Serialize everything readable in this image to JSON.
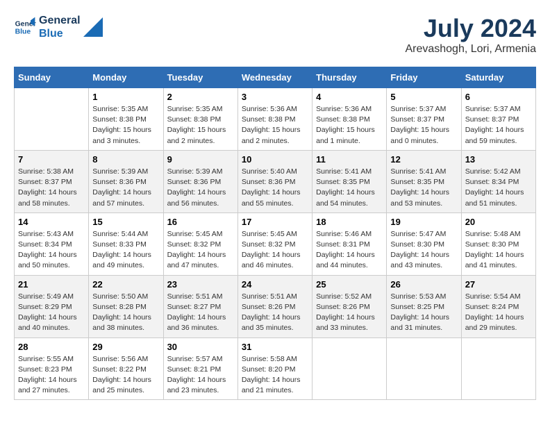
{
  "logo": {
    "line1": "General",
    "line2": "Blue"
  },
  "title": "July 2024",
  "subtitle": "Arevashogh, Lori, Armenia",
  "days_of_week": [
    "Sunday",
    "Monday",
    "Tuesday",
    "Wednesday",
    "Thursday",
    "Friday",
    "Saturday"
  ],
  "weeks": [
    [
      {
        "day": "",
        "sunrise": "",
        "sunset": "",
        "daylight": ""
      },
      {
        "day": "1",
        "sunrise": "Sunrise: 5:35 AM",
        "sunset": "Sunset: 8:38 PM",
        "daylight": "Daylight: 15 hours and 3 minutes."
      },
      {
        "day": "2",
        "sunrise": "Sunrise: 5:35 AM",
        "sunset": "Sunset: 8:38 PM",
        "daylight": "Daylight: 15 hours and 2 minutes."
      },
      {
        "day": "3",
        "sunrise": "Sunrise: 5:36 AM",
        "sunset": "Sunset: 8:38 PM",
        "daylight": "Daylight: 15 hours and 2 minutes."
      },
      {
        "day": "4",
        "sunrise": "Sunrise: 5:36 AM",
        "sunset": "Sunset: 8:38 PM",
        "daylight": "Daylight: 15 hours and 1 minute."
      },
      {
        "day": "5",
        "sunrise": "Sunrise: 5:37 AM",
        "sunset": "Sunset: 8:37 PM",
        "daylight": "Daylight: 15 hours and 0 minutes."
      },
      {
        "day": "6",
        "sunrise": "Sunrise: 5:37 AM",
        "sunset": "Sunset: 8:37 PM",
        "daylight": "Daylight: 14 hours and 59 minutes."
      }
    ],
    [
      {
        "day": "7",
        "sunrise": "Sunrise: 5:38 AM",
        "sunset": "Sunset: 8:37 PM",
        "daylight": "Daylight: 14 hours and 58 minutes."
      },
      {
        "day": "8",
        "sunrise": "Sunrise: 5:39 AM",
        "sunset": "Sunset: 8:36 PM",
        "daylight": "Daylight: 14 hours and 57 minutes."
      },
      {
        "day": "9",
        "sunrise": "Sunrise: 5:39 AM",
        "sunset": "Sunset: 8:36 PM",
        "daylight": "Daylight: 14 hours and 56 minutes."
      },
      {
        "day": "10",
        "sunrise": "Sunrise: 5:40 AM",
        "sunset": "Sunset: 8:36 PM",
        "daylight": "Daylight: 14 hours and 55 minutes."
      },
      {
        "day": "11",
        "sunrise": "Sunrise: 5:41 AM",
        "sunset": "Sunset: 8:35 PM",
        "daylight": "Daylight: 14 hours and 54 minutes."
      },
      {
        "day": "12",
        "sunrise": "Sunrise: 5:41 AM",
        "sunset": "Sunset: 8:35 PM",
        "daylight": "Daylight: 14 hours and 53 minutes."
      },
      {
        "day": "13",
        "sunrise": "Sunrise: 5:42 AM",
        "sunset": "Sunset: 8:34 PM",
        "daylight": "Daylight: 14 hours and 51 minutes."
      }
    ],
    [
      {
        "day": "14",
        "sunrise": "Sunrise: 5:43 AM",
        "sunset": "Sunset: 8:34 PM",
        "daylight": "Daylight: 14 hours and 50 minutes."
      },
      {
        "day": "15",
        "sunrise": "Sunrise: 5:44 AM",
        "sunset": "Sunset: 8:33 PM",
        "daylight": "Daylight: 14 hours and 49 minutes."
      },
      {
        "day": "16",
        "sunrise": "Sunrise: 5:45 AM",
        "sunset": "Sunset: 8:32 PM",
        "daylight": "Daylight: 14 hours and 47 minutes."
      },
      {
        "day": "17",
        "sunrise": "Sunrise: 5:45 AM",
        "sunset": "Sunset: 8:32 PM",
        "daylight": "Daylight: 14 hours and 46 minutes."
      },
      {
        "day": "18",
        "sunrise": "Sunrise: 5:46 AM",
        "sunset": "Sunset: 8:31 PM",
        "daylight": "Daylight: 14 hours and 44 minutes."
      },
      {
        "day": "19",
        "sunrise": "Sunrise: 5:47 AM",
        "sunset": "Sunset: 8:30 PM",
        "daylight": "Daylight: 14 hours and 43 minutes."
      },
      {
        "day": "20",
        "sunrise": "Sunrise: 5:48 AM",
        "sunset": "Sunset: 8:30 PM",
        "daylight": "Daylight: 14 hours and 41 minutes."
      }
    ],
    [
      {
        "day": "21",
        "sunrise": "Sunrise: 5:49 AM",
        "sunset": "Sunset: 8:29 PM",
        "daylight": "Daylight: 14 hours and 40 minutes."
      },
      {
        "day": "22",
        "sunrise": "Sunrise: 5:50 AM",
        "sunset": "Sunset: 8:28 PM",
        "daylight": "Daylight: 14 hours and 38 minutes."
      },
      {
        "day": "23",
        "sunrise": "Sunrise: 5:51 AM",
        "sunset": "Sunset: 8:27 PM",
        "daylight": "Daylight: 14 hours and 36 minutes."
      },
      {
        "day": "24",
        "sunrise": "Sunrise: 5:51 AM",
        "sunset": "Sunset: 8:26 PM",
        "daylight": "Daylight: 14 hours and 35 minutes."
      },
      {
        "day": "25",
        "sunrise": "Sunrise: 5:52 AM",
        "sunset": "Sunset: 8:26 PM",
        "daylight": "Daylight: 14 hours and 33 minutes."
      },
      {
        "day": "26",
        "sunrise": "Sunrise: 5:53 AM",
        "sunset": "Sunset: 8:25 PM",
        "daylight": "Daylight: 14 hours and 31 minutes."
      },
      {
        "day": "27",
        "sunrise": "Sunrise: 5:54 AM",
        "sunset": "Sunset: 8:24 PM",
        "daylight": "Daylight: 14 hours and 29 minutes."
      }
    ],
    [
      {
        "day": "28",
        "sunrise": "Sunrise: 5:55 AM",
        "sunset": "Sunset: 8:23 PM",
        "daylight": "Daylight: 14 hours and 27 minutes."
      },
      {
        "day": "29",
        "sunrise": "Sunrise: 5:56 AM",
        "sunset": "Sunset: 8:22 PM",
        "daylight": "Daylight: 14 hours and 25 minutes."
      },
      {
        "day": "30",
        "sunrise": "Sunrise: 5:57 AM",
        "sunset": "Sunset: 8:21 PM",
        "daylight": "Daylight: 14 hours and 23 minutes."
      },
      {
        "day": "31",
        "sunrise": "Sunrise: 5:58 AM",
        "sunset": "Sunset: 8:20 PM",
        "daylight": "Daylight: 14 hours and 21 minutes."
      },
      {
        "day": "",
        "sunrise": "",
        "sunset": "",
        "daylight": ""
      },
      {
        "day": "",
        "sunrise": "",
        "sunset": "",
        "daylight": ""
      },
      {
        "day": "",
        "sunrise": "",
        "sunset": "",
        "daylight": ""
      }
    ]
  ]
}
